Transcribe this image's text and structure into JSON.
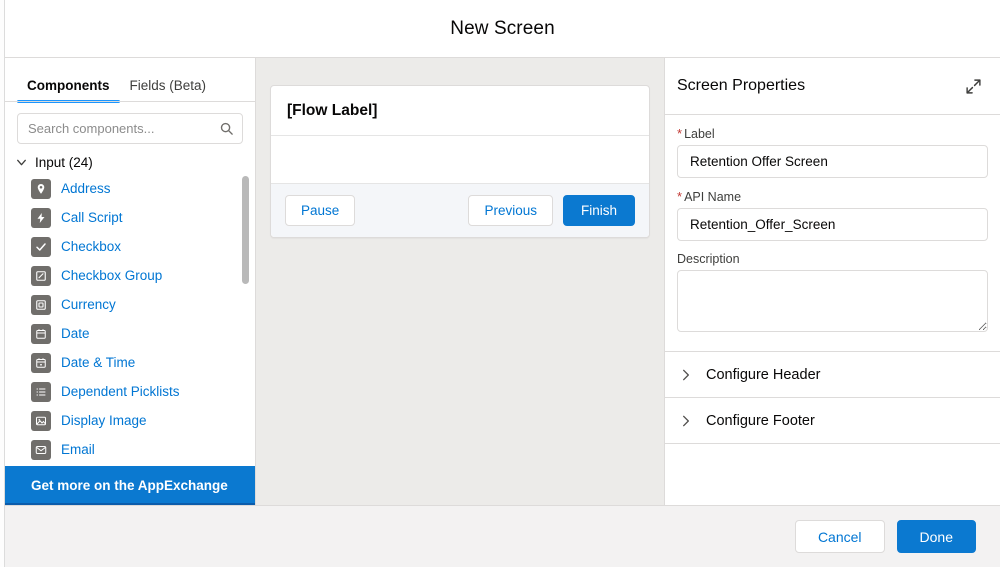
{
  "header": {
    "title": "New Screen"
  },
  "left_panel": {
    "tabs": [
      {
        "label": "Components",
        "active": true
      },
      {
        "label": "Fields (Beta)",
        "active": false
      }
    ],
    "search": {
      "placeholder": "Search components...",
      "value": "",
      "icon": "search-icon"
    },
    "group": {
      "label": "Input (24)",
      "icon": "chevron-down-icon",
      "expanded": true
    },
    "components": [
      {
        "label": "Address",
        "icon": "location-pin-icon"
      },
      {
        "label": "Call Script",
        "icon": "lightning-bolt-icon"
      },
      {
        "label": "Checkbox",
        "icon": "checkmark-icon"
      },
      {
        "label": "Checkbox Group",
        "icon": "checkbox-group-icon"
      },
      {
        "label": "Currency",
        "icon": "currency-icon"
      },
      {
        "label": "Date",
        "icon": "calendar-icon"
      },
      {
        "label": "Date & Time",
        "icon": "calendar-clock-icon"
      },
      {
        "label": "Dependent Picklists",
        "icon": "list-icon"
      },
      {
        "label": "Display Image",
        "icon": "image-icon"
      },
      {
        "label": "Email",
        "icon": "envelope-icon"
      }
    ],
    "appexchange_button": "Get more on the AppExchange"
  },
  "canvas": {
    "flow_label": "[Flow Label]",
    "footer_buttons": {
      "pause": "Pause",
      "previous": "Previous",
      "finish": "Finish"
    }
  },
  "right_panel": {
    "title": "Screen Properties",
    "expand_icon": "expand-icon",
    "fields": {
      "label": {
        "label": "Label",
        "value": "Retention Offer Screen",
        "required": true
      },
      "api_name": {
        "label": "API Name",
        "value": "Retention_Offer_Screen",
        "required": true
      },
      "description": {
        "label": "Description",
        "value": "",
        "required": false
      }
    },
    "accordions": [
      {
        "label": "Configure Header",
        "icon": "chevron-right-icon",
        "expanded": false
      },
      {
        "label": "Configure Footer",
        "icon": "chevron-right-icon",
        "expanded": false
      }
    ]
  },
  "footer": {
    "cancel": "Cancel",
    "done": "Done"
  },
  "colors": {
    "brand_blue": "#0b79d0",
    "link_blue": "#0176d3",
    "active_tab_underline": "#1b96ff",
    "canvas_bg": "#ecebe9",
    "footer_bg": "#f3f2f2",
    "required_red": "#c23934",
    "icon_gray": "#706e6b"
  }
}
